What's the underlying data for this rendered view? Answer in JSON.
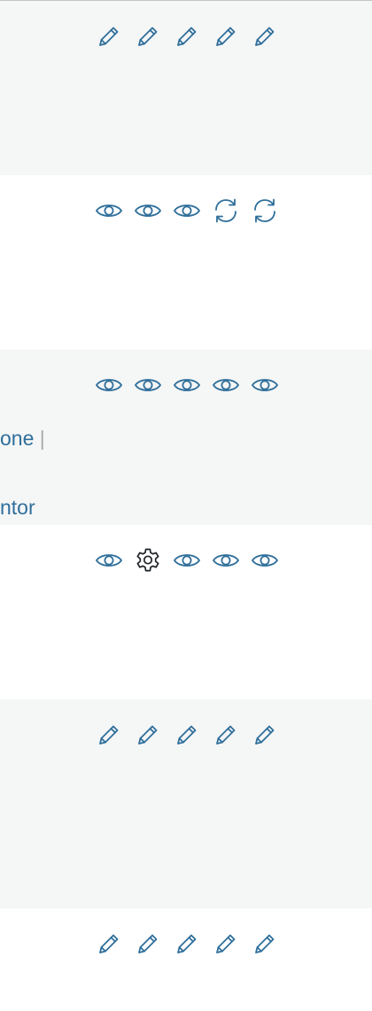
{
  "colors": {
    "icon": "#2f6f9b",
    "icon_dark": "#1d2327",
    "row_alt": "#f5f6f6",
    "link": "#2f6f9b",
    "separator": "#a7aaad"
  },
  "rows": [
    {
      "icons": [
        "pencil-icon",
        "pencil-icon",
        "pencil-icon",
        "pencil-icon",
        "pencil-icon"
      ]
    },
    {
      "icons": [
        "eye-icon",
        "eye-icon",
        "eye-icon",
        "refresh-icon",
        "refresh-icon"
      ]
    },
    {
      "icons": [
        "eye-icon",
        "eye-icon",
        "eye-icon",
        "eye-icon",
        "eye-icon"
      ],
      "links": {
        "line1": "one",
        "separator": "|",
        "line2": "ntor"
      }
    },
    {
      "icons": [
        "eye-icon",
        "gear-icon",
        "eye-icon",
        "eye-icon",
        "eye-icon"
      ]
    },
    {
      "icons": [
        "pencil-icon",
        "pencil-icon",
        "pencil-icon",
        "pencil-icon",
        "pencil-icon"
      ]
    },
    {
      "icons": [
        "pencil-icon",
        "pencil-icon",
        "pencil-icon",
        "pencil-icon",
        "pencil-icon"
      ]
    }
  ]
}
